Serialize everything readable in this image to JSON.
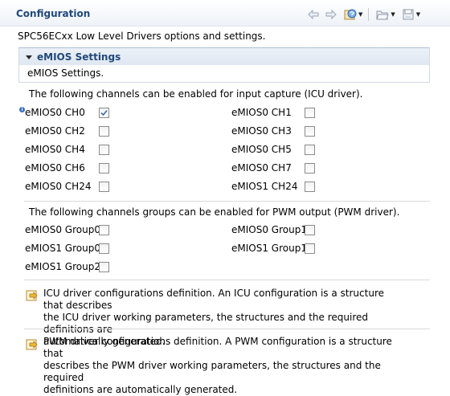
{
  "header": {
    "title": "Configuration",
    "toolbar": [
      {
        "icon": "back-arrow-icon"
      },
      {
        "icon": "forward-arrow-icon"
      },
      {
        "icon": "help-contents-icon"
      },
      {
        "icon": "open-folder-icon"
      },
      {
        "icon": "save-disk-icon"
      }
    ]
  },
  "subtitle": "SPC56ECxx Low Level Drivers options and settings.",
  "section": {
    "title": "eMIOS Settings",
    "description": "eMIOS Settings."
  },
  "icu": {
    "label": "The following channels can be enabled for input capture (ICU driver).",
    "channels": [
      {
        "label": "eMIOS0 CH0",
        "checked": true
      },
      {
        "label": "eMIOS0 CH1",
        "checked": false
      },
      {
        "label": "eMIOS0 CH2",
        "checked": false
      },
      {
        "label": "eMIOS0 CH3",
        "checked": false
      },
      {
        "label": "eMIOS0 CH4",
        "checked": false
      },
      {
        "label": "eMIOS0 CH5",
        "checked": false
      },
      {
        "label": "eMIOS0 CH6",
        "checked": false
      },
      {
        "label": "eMIOS0 CH7",
        "checked": false
      },
      {
        "label": "eMIOS0 CH24",
        "checked": false
      },
      {
        "label": "eMIOS1 CH24",
        "checked": false
      }
    ]
  },
  "pwm": {
    "label": "The following channels groups can be enabled for PWM output (PWM driver).",
    "groups": [
      {
        "label": "eMIOS0 Group0",
        "checked": false
      },
      {
        "label": "eMIOS0 Group1",
        "checked": false
      },
      {
        "label": "eMIOS1 Group0",
        "checked": false
      },
      {
        "label": "eMIOS1 Group1",
        "checked": false
      },
      {
        "label": "eMIOS1 Group2",
        "checked": false
      }
    ]
  },
  "definitions": [
    {
      "lines": [
        "ICU driver configurations definition. An ICU configuration is a structure that describes",
        "the ICU driver working parameters, the structures and the required definitions are",
        "automatically generated."
      ]
    },
    {
      "lines": [
        "PWM driver configurations definition. A PWM configuration is a structure that",
        "describes the PWM driver working parameters, the structures and the required",
        "definitions are automatically generated."
      ]
    }
  ]
}
